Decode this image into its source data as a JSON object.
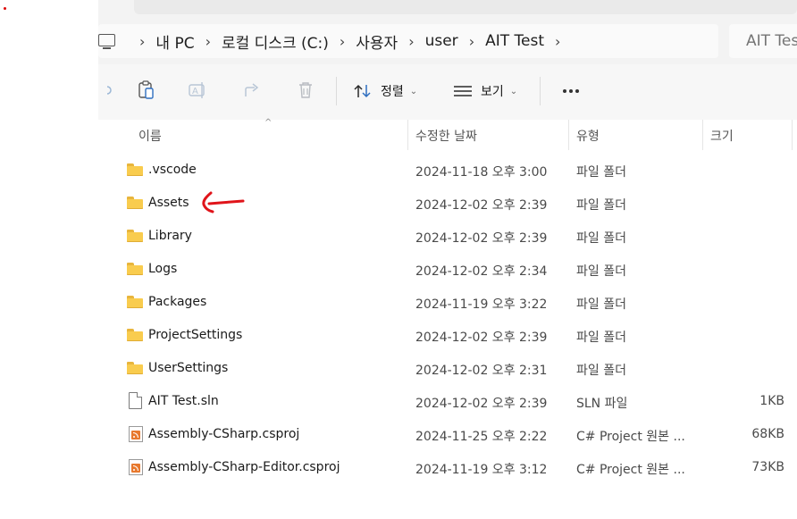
{
  "breadcrumb": {
    "items": [
      "내 PC",
      "로컬 디스크 (C:)",
      "사용자",
      "user",
      "AIT Test"
    ]
  },
  "search": {
    "placeholder": "AIT Test"
  },
  "toolbar": {
    "sort_label": "정렬",
    "view_label": "보기"
  },
  "columns": {
    "name": "이름",
    "date": "수정한 날짜",
    "type": "유형",
    "size": "크기"
  },
  "files": [
    {
      "name": ".vscode",
      "date": "2024-11-18 오후 3:00",
      "type": "파일 폴더",
      "size": "",
      "icon": "folder-icon"
    },
    {
      "name": "Assets",
      "date": "2024-12-02 오후 2:39",
      "type": "파일 폴더",
      "size": "",
      "icon": "folder-icon"
    },
    {
      "name": "Library",
      "date": "2024-12-02 오후 2:39",
      "type": "파일 폴더",
      "size": "",
      "icon": "folder-icon"
    },
    {
      "name": "Logs",
      "date": "2024-12-02 오후 2:34",
      "type": "파일 폴더",
      "size": "",
      "icon": "folder-icon"
    },
    {
      "name": "Packages",
      "date": "2024-11-19 오후 3:22",
      "type": "파일 폴더",
      "size": "",
      "icon": "folder-icon"
    },
    {
      "name": "ProjectSettings",
      "date": "2024-12-02 오후 2:39",
      "type": "파일 폴더",
      "size": "",
      "icon": "folder-icon"
    },
    {
      "name": "UserSettings",
      "date": "2024-12-02 오후 2:31",
      "type": "파일 폴더",
      "size": "",
      "icon": "folder-icon"
    },
    {
      "name": "AIT Test.sln",
      "date": "2024-12-02 오후 2:39",
      "type": "SLN 파일",
      "size": "1KB",
      "icon": "document-icon"
    },
    {
      "name": "Assembly-CSharp.csproj",
      "date": "2024-11-25 오후 2:22",
      "type": "C# Project 원본 ...",
      "size": "68KB",
      "icon": "csproj-icon"
    },
    {
      "name": "Assembly-CSharp-Editor.csproj",
      "date": "2024-11-19 오후 3:12",
      "type": "C# Project 원본 ...",
      "size": "73KB",
      "icon": "csproj-icon"
    }
  ],
  "colors": {
    "folder": "#f9cc4e",
    "annotation": "#e0141a",
    "toolbar_bg": "#f7f7f7"
  }
}
